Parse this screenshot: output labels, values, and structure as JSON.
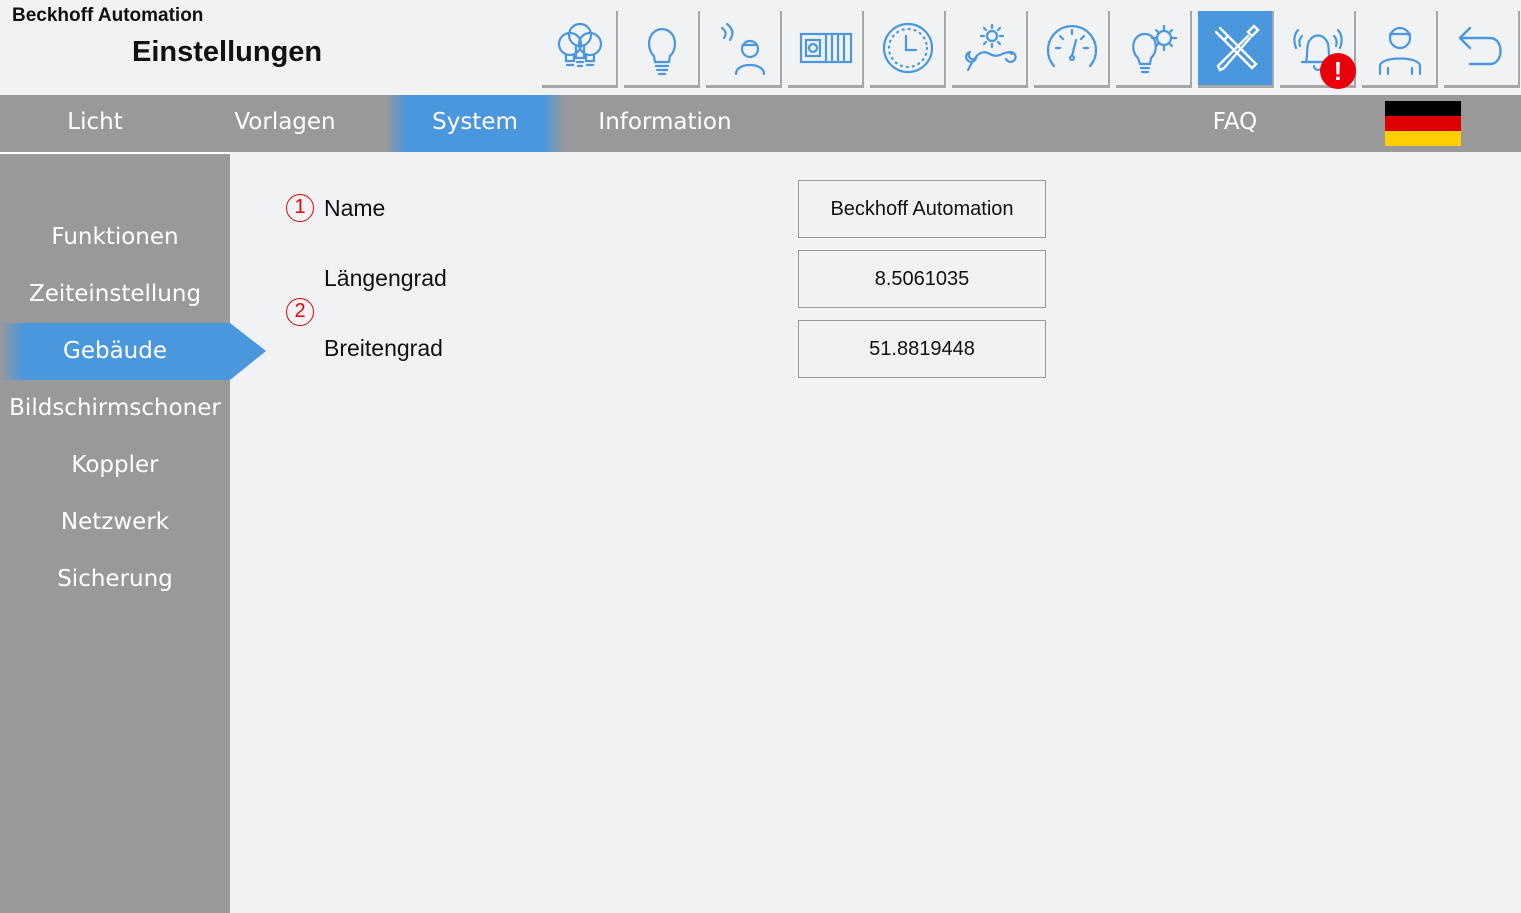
{
  "header": {
    "company": "Beckhoff Automation",
    "title": "Einstellungen",
    "alarm_badge": "!"
  },
  "toolbar": [
    {
      "icon": "multi-bulb-icon"
    },
    {
      "icon": "bulb-icon"
    },
    {
      "icon": "presence-sensor-icon"
    },
    {
      "icon": "window-blind-icon"
    },
    {
      "icon": "clock-icon"
    },
    {
      "icon": "sun-moon-icon"
    },
    {
      "icon": "gauge-icon"
    },
    {
      "icon": "bulb-gear-icon"
    },
    {
      "icon": "tools-icon",
      "active": true
    },
    {
      "icon": "alarm-bell-icon"
    },
    {
      "icon": "user-icon"
    },
    {
      "icon": "back-arrow-icon"
    }
  ],
  "nav": {
    "tabs": [
      "Licht",
      "Vorlagen",
      "System",
      "Information"
    ],
    "faq": "FAQ",
    "active": "System"
  },
  "sidebar": {
    "items": [
      "Funktionen",
      "Zeiteinstellung",
      "Gebäude",
      "Bildschirmschoner",
      "Koppler",
      "Netzwerk",
      "Sicherung"
    ],
    "active": "Gebäude"
  },
  "content": {
    "marker1": "1",
    "marker2": "2",
    "name_label": "Name",
    "name_value": "Beckhoff Automation",
    "longitude_label": "Längengrad",
    "longitude_value": "8.5061035",
    "latitude_label": "Breitengrad",
    "latitude_value": "51.8819448"
  },
  "colors": {
    "accent": "#4a97dd",
    "bar": "#999999",
    "background": "#f0f2f4",
    "alert": "#e8000b"
  }
}
